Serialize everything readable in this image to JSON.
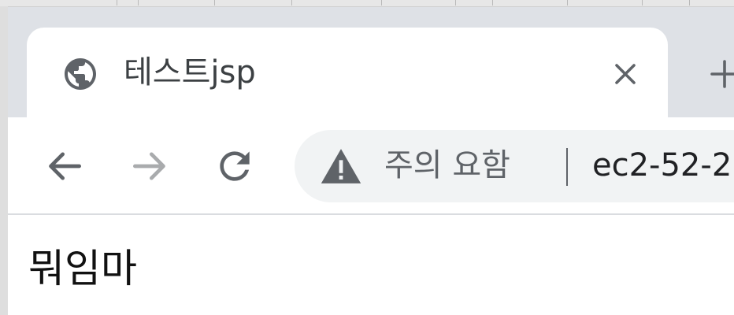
{
  "tab": {
    "title": "테스트jsp",
    "favicon": "globe-icon",
    "close_icon": "close-icon"
  },
  "new_tab_icon": "plus-icon",
  "toolbar": {
    "back_icon": "arrow-left-icon",
    "forward_icon": "arrow-right-icon",
    "reload_icon": "reload-icon"
  },
  "omnibox": {
    "security_icon": "warning-icon",
    "security_label": "주의 요함",
    "url": "ec2-52-2"
  },
  "page": {
    "text": "뭐임마"
  },
  "colors": {
    "tabstrip": "#dee1e6",
    "omnibox_bg": "#f1f3f4",
    "icon": "#5f6368",
    "disabled_icon": "#a9abad"
  }
}
